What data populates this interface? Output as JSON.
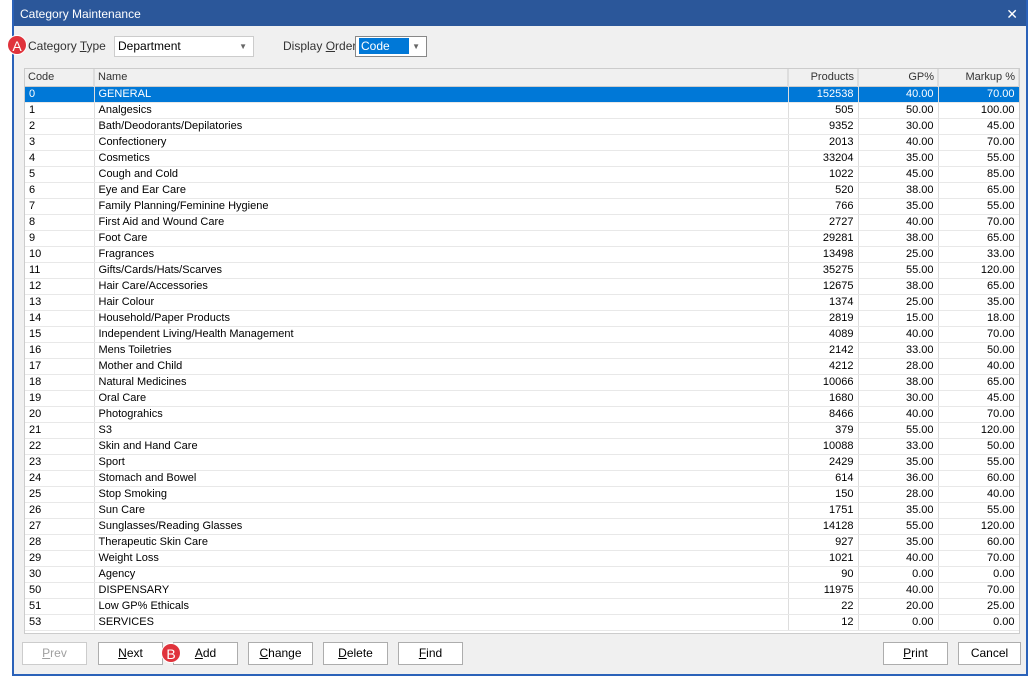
{
  "window": {
    "title": "Category Maintenance",
    "close": "✕"
  },
  "filters": {
    "category_type_label_pre": "Category ",
    "category_type_label_key": "T",
    "category_type_label_post": "ype",
    "category_type_value": "Department",
    "display_order_label_pre": "Display ",
    "display_order_label_key": "O",
    "display_order_label_post": "rder",
    "display_order_value": "Code"
  },
  "badges": {
    "a": "A",
    "b": "B"
  },
  "table": {
    "columns": [
      "Code",
      "Name",
      "Products",
      "GP%",
      "Markup %"
    ],
    "rows": [
      [
        "0",
        "GENERAL",
        "152538",
        "40.00",
        "70.00"
      ],
      [
        "1",
        "Analgesics",
        "505",
        "50.00",
        "100.00"
      ],
      [
        "2",
        "Bath/Deodorants/Depilatories",
        "9352",
        "30.00",
        "45.00"
      ],
      [
        "3",
        "Confectionery",
        "2013",
        "40.00",
        "70.00"
      ],
      [
        "4",
        "Cosmetics",
        "33204",
        "35.00",
        "55.00"
      ],
      [
        "5",
        "Cough and Cold",
        "1022",
        "45.00",
        "85.00"
      ],
      [
        "6",
        "Eye and Ear Care",
        "520",
        "38.00",
        "65.00"
      ],
      [
        "7",
        "Family Planning/Feminine Hygiene",
        "766",
        "35.00",
        "55.00"
      ],
      [
        "8",
        "First Aid and Wound Care",
        "2727",
        "40.00",
        "70.00"
      ],
      [
        "9",
        "Foot Care",
        "29281",
        "38.00",
        "65.00"
      ],
      [
        "10",
        "Fragrances",
        "13498",
        "25.00",
        "33.00"
      ],
      [
        "11",
        "Gifts/Cards/Hats/Scarves",
        "35275",
        "55.00",
        "120.00"
      ],
      [
        "12",
        "Hair Care/Accessories",
        "12675",
        "38.00",
        "65.00"
      ],
      [
        "13",
        "Hair Colour",
        "1374",
        "25.00",
        "35.00"
      ],
      [
        "14",
        "Household/Paper Products",
        "2819",
        "15.00",
        "18.00"
      ],
      [
        "15",
        "Independent Living/Health Management",
        "4089",
        "40.00",
        "70.00"
      ],
      [
        "16",
        "Mens Toiletries",
        "2142",
        "33.00",
        "50.00"
      ],
      [
        "17",
        "Mother and Child",
        "4212",
        "28.00",
        "40.00"
      ],
      [
        "18",
        "Natural Medicines",
        "10066",
        "38.00",
        "65.00"
      ],
      [
        "19",
        "Oral Care",
        "1680",
        "30.00",
        "45.00"
      ],
      [
        "20",
        "Photograhics",
        "8466",
        "40.00",
        "70.00"
      ],
      [
        "21",
        "S3",
        "379",
        "55.00",
        "120.00"
      ],
      [
        "22",
        "Skin and Hand Care",
        "10088",
        "33.00",
        "50.00"
      ],
      [
        "23",
        "Sport",
        "2429",
        "35.00",
        "55.00"
      ],
      [
        "24",
        "Stomach and Bowel",
        "614",
        "36.00",
        "60.00"
      ],
      [
        "25",
        "Stop Smoking",
        "150",
        "28.00",
        "40.00"
      ],
      [
        "26",
        "Sun Care",
        "1751",
        "35.00",
        "55.00"
      ],
      [
        "27",
        "Sunglasses/Reading Glasses",
        "14128",
        "55.00",
        "120.00"
      ],
      [
        "28",
        "Therapeutic Skin Care",
        "927",
        "35.00",
        "60.00"
      ],
      [
        "29",
        "Weight Loss",
        "1021",
        "40.00",
        "70.00"
      ],
      [
        "30",
        "Agency",
        "90",
        "0.00",
        "0.00"
      ],
      [
        "50",
        "DISPENSARY",
        "11975",
        "40.00",
        "70.00"
      ],
      [
        "51",
        "Low GP% Ethicals",
        "22",
        "20.00",
        "25.00"
      ],
      [
        "53",
        "SERVICES",
        "12",
        "0.00",
        "0.00"
      ]
    ]
  },
  "buttons": [
    {
      "key": "P",
      "rest": "rev",
      "name": "prev-button",
      "disabled": true
    },
    {
      "key": "N",
      "rest": "ext",
      "name": "next-button"
    },
    {
      "key": "A",
      "rest": "dd",
      "name": "add-button"
    },
    {
      "key": "C",
      "rest": "hange",
      "name": "change-button"
    },
    {
      "key": "D",
      "rest": "elete",
      "name": "delete-button"
    },
    {
      "key": "F",
      "rest": "ind",
      "name": "find-button"
    },
    {
      "key": "P",
      "rest": "rint",
      "name": "print-button"
    },
    {
      "key": "",
      "rest": "Cancel",
      "name": "cancel-button"
    }
  ]
}
